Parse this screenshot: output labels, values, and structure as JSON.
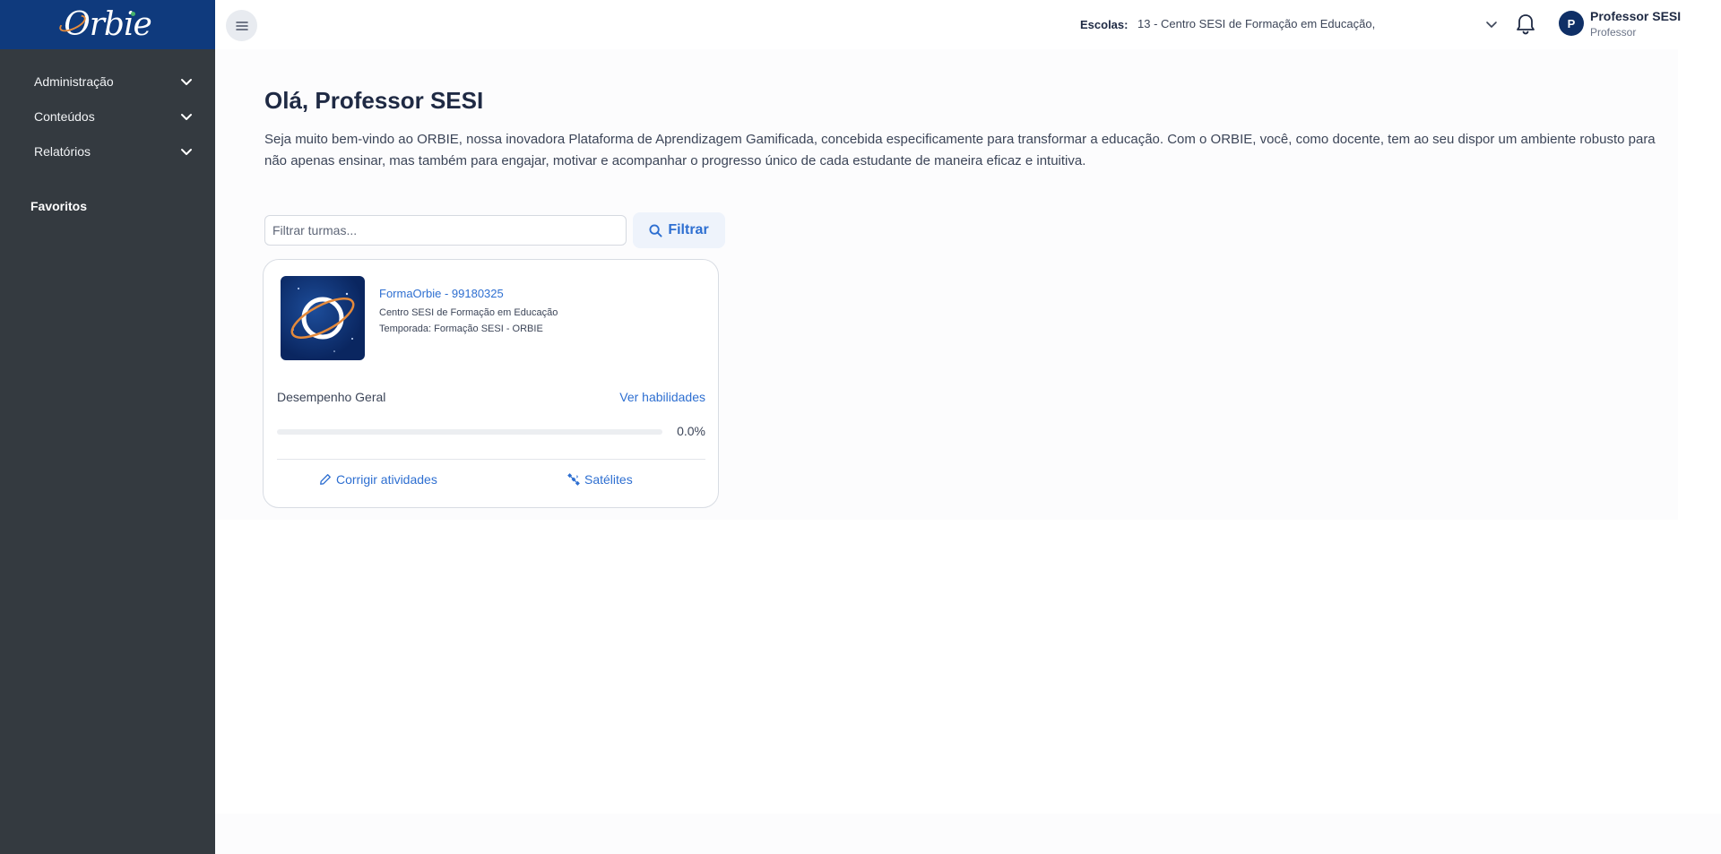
{
  "app": {
    "logo_text": "Orbie"
  },
  "sidebar": {
    "items": [
      {
        "label": "Administração"
      },
      {
        "label": "Conteúdos"
      },
      {
        "label": "Relatórios"
      }
    ],
    "favorites_label": "Favoritos"
  },
  "header": {
    "school_label": "Escolas:",
    "school_value": "13 - Centro SESI de Formação em Educação,",
    "user": {
      "initial": "P",
      "name": "Professor SESI",
      "role": "Professor"
    }
  },
  "main": {
    "greeting": "Olá, Professor SESI",
    "intro": "Seja muito bem-vindo ao ORBIE, nossa inovadora Plataforma de Aprendizagem Gamificada, concebida especificamente para transformar a educação. Com o ORBIE, você, como docente, tem ao seu dispor um ambiente robusto para não apenas ensinar, mas também para engajar, motivar e acompanhar o progresso único de cada estudante de maneira eficaz e intuitiva.",
    "filter": {
      "placeholder": "Filtrar turmas...",
      "button_label": "Filtrar"
    },
    "class_card": {
      "title": "FormaOrbie - 99180325",
      "school": "Centro SESI de Formação em Educação",
      "season": "Temporada: Formação SESI - ORBIE",
      "performance_label": "Desempenho Geral",
      "skills_link": "Ver habilidades",
      "progress": 0.0,
      "progress_text": "0.0%",
      "fix_activities_label": "Corrigir atividades",
      "satellites_label": "Satélites"
    }
  },
  "colors": {
    "brand": "#0f3a7d",
    "accent": "#2e6fd1",
    "sidebar": "#343a40"
  },
  "icons": [
    "menu-icon",
    "chevron-down-icon",
    "bell-icon",
    "search-icon",
    "pencil-icon",
    "satellite-icon"
  ]
}
